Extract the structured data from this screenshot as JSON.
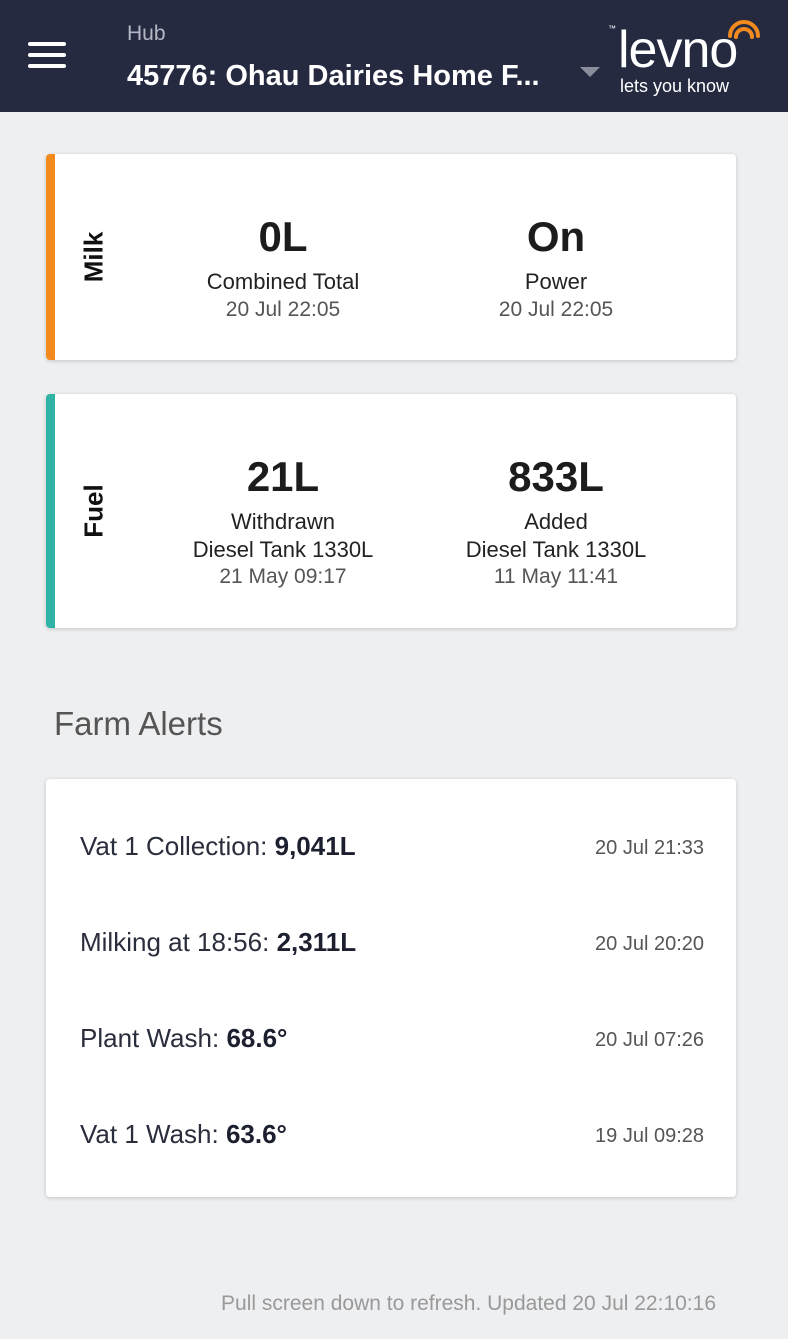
{
  "header": {
    "hub_label": "Hub",
    "hub_name": "45776: Ohau Dairies Home F...",
    "logo_tm": "™",
    "logo_word": "levno",
    "logo_tagline": "lets you know"
  },
  "milk_card": {
    "label": "Milk",
    "accent_color": "#f28a1d",
    "metrics": [
      {
        "value": "0L",
        "label": "Combined Total",
        "time": "20 Jul 22:05"
      },
      {
        "value": "On",
        "label": "Power",
        "time": "20 Jul 22:05"
      }
    ]
  },
  "fuel_card": {
    "label": "Fuel",
    "accent_color": "#2fb3a5",
    "metrics": [
      {
        "value": "21L",
        "label": "Withdrawn",
        "sublabel": "Diesel Tank 1330L",
        "time": "21 May 09:17"
      },
      {
        "value": "833L",
        "label": "Added",
        "sublabel": "Diesel Tank 1330L",
        "time": "11 May 11:41"
      }
    ]
  },
  "alerts": {
    "title": "Farm Alerts",
    "items": [
      {
        "prefix": "Vat 1 Collection: ",
        "value": "9,041L",
        "time": "20 Jul 21:33"
      },
      {
        "prefix": "Milking at 18:56: ",
        "value": "2,311L",
        "time": "20 Jul 20:20"
      },
      {
        "prefix": "Plant Wash: ",
        "value": "68.6°",
        "time": "20 Jul 07:26"
      },
      {
        "prefix": "Vat 1 Wash: ",
        "value": "63.6°",
        "time": "19 Jul 09:28"
      }
    ]
  },
  "footer": {
    "text": "Pull screen down to refresh. Updated 20 Jul 22:10:16"
  },
  "colors": {
    "header_bg": "#252a41",
    "brand_orange": "#f28a1d",
    "fuel_teal": "#2fb3a5"
  }
}
